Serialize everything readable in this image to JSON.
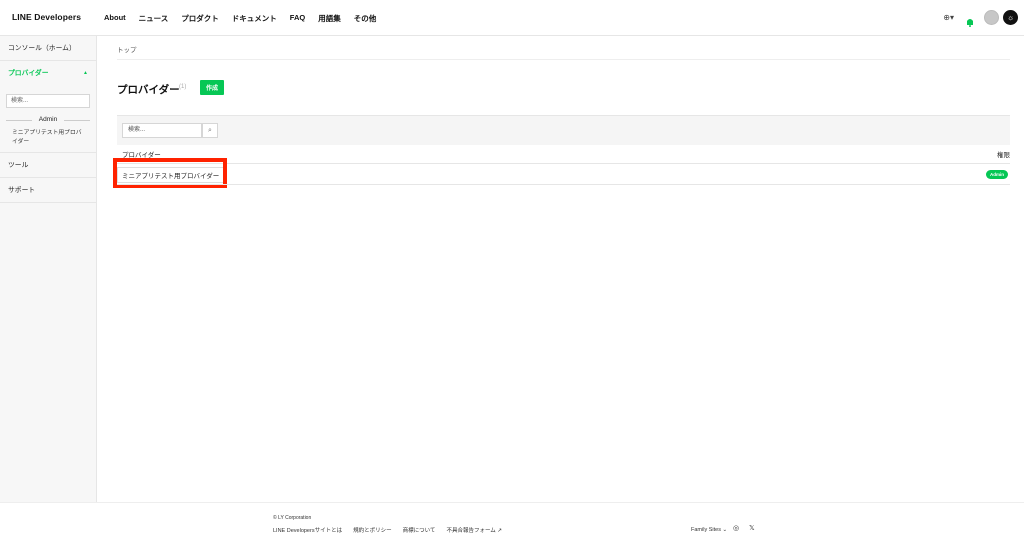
{
  "header": {
    "logo": "LINE Developers",
    "nav": [
      "About",
      "ニュース",
      "プロダクト",
      "ドキュメント",
      "FAQ",
      "用語集",
      "その他"
    ],
    "globe_icon": "⊕▾",
    "dark_icon": "☼"
  },
  "sidebar": {
    "console_home": "コンソール（ホーム）",
    "providers": "プロバイダー",
    "providers_caret": "▲",
    "search_placeholder": "検索...",
    "admin_label": "Admin",
    "provider_item": "ミニアプリテスト用プロバイダー",
    "tools": "ツール",
    "support": "サポート"
  },
  "main": {
    "breadcrumb": "トップ",
    "title": "プロバイダー",
    "count": "(1)",
    "create_label": "作成",
    "search_placeholder": "検索...",
    "search_icon": "⌕",
    "col_provider": "プロバイダー",
    "col_role": "権限",
    "rows": [
      {
        "name": "ミニアプリテスト用プロバイダー",
        "role": "Admin"
      }
    ]
  },
  "footer": {
    "copyright": "© LY Corporation",
    "links": [
      "LINE Developersサイトとは",
      "規約とポリシー",
      "商標について",
      "不具合報告フォーム ↗"
    ],
    "family_sites": "Family Sites ⌄",
    "icon_chat": "◎",
    "icon_x": "𝕏"
  },
  "colors": {
    "accent": "#06c755",
    "highlight": "#ff2200"
  }
}
